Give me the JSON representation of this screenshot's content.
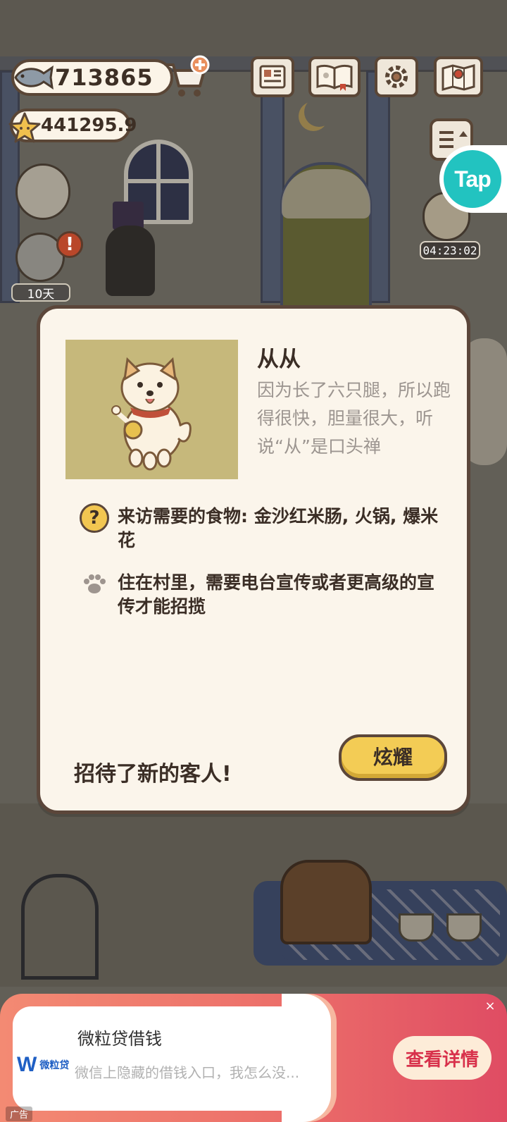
{
  "hud": {
    "fish_count": "713865",
    "star_count": "441295.9",
    "timer": "04:23:02",
    "days": "10天",
    "tap_label": "Tap"
  },
  "icons": {
    "fish": "fish-icon",
    "star": "star-icon",
    "cart": "shop-cart-icon",
    "newspaper": "newspaper-icon",
    "album": "album-book-icon",
    "settings": "gear-icon",
    "map": "map-icon",
    "menu": "menu-list-icon",
    "question": "question-icon",
    "paw": "paw-icon"
  },
  "modal": {
    "guest_name": "从从",
    "guest_description": "因为长了六只腿，所以跑得很快，胆量很大，听说“从”是口头禅",
    "food_info": "来访需要的食物: 金沙红米肠, 火锅, 爆米花",
    "residence_info": "住在村里，需要电台宣传或者更高级的宣传才能招揽",
    "footer_text": "招待了新的客人!",
    "show_off_button": "炫耀"
  },
  "ad": {
    "logo_mark": "W",
    "logo_text": "微粒贷",
    "title": "微粒贷借钱",
    "description": "微信上隐藏的借钱入口，我怎么没...",
    "cta": "查看详情",
    "close": "×",
    "tag": "广告"
  },
  "colors": {
    "card_bg": "#fbf5eb",
    "card_border": "#5b463a",
    "button_yellow": "#f3cc55",
    "portrait_bg": "#c6b87b",
    "ad_gradient_end": "#df4c63",
    "tap_teal": "#22c3c0"
  }
}
